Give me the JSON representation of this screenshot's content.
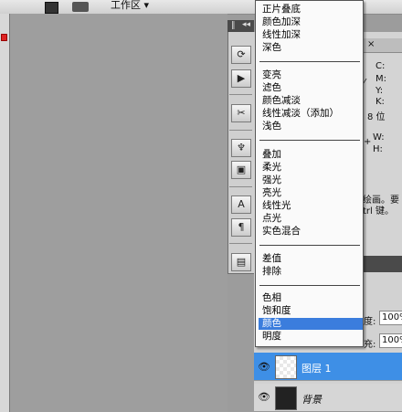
{
  "topbar": {
    "workspace_label": "工作区 ▾"
  },
  "blend_menu": {
    "group1": [
      "正片叠底",
      "颜色加深",
      "线性加深",
      "深色"
    ],
    "group2": [
      "变亮",
      "滤色",
      "颜色减淡",
      "线性减淡（添加）",
      "浅色"
    ],
    "group3": [
      "叠加",
      "柔光",
      "强光",
      "亮光",
      "线性光",
      "点光",
      "实色混合"
    ],
    "group4": [
      "差值",
      "排除"
    ],
    "group5": [
      "色相",
      "饱和度",
      "颜色",
      "明度"
    ],
    "selected": "颜色"
  },
  "info_panel": {
    "channels": [
      "C:",
      "M:",
      "Y:",
      "K:"
    ],
    "bit_depth": "8 位",
    "dims": [
      "W:",
      "H:"
    ],
    "help_text_1": "绘画。要",
    "help_text_2": "trl 键。"
  },
  "layers_panel": {
    "opacity_label": "度:",
    "opacity_value": "100%",
    "fill_label": "充:",
    "fill_value": "100%",
    "layers": [
      {
        "name": "图层 1",
        "selected": true
      },
      {
        "name": "背景",
        "selected": false
      }
    ]
  },
  "colors": {
    "selection": "#3b7ddd",
    "layer_selected": "#3e8fe6"
  }
}
